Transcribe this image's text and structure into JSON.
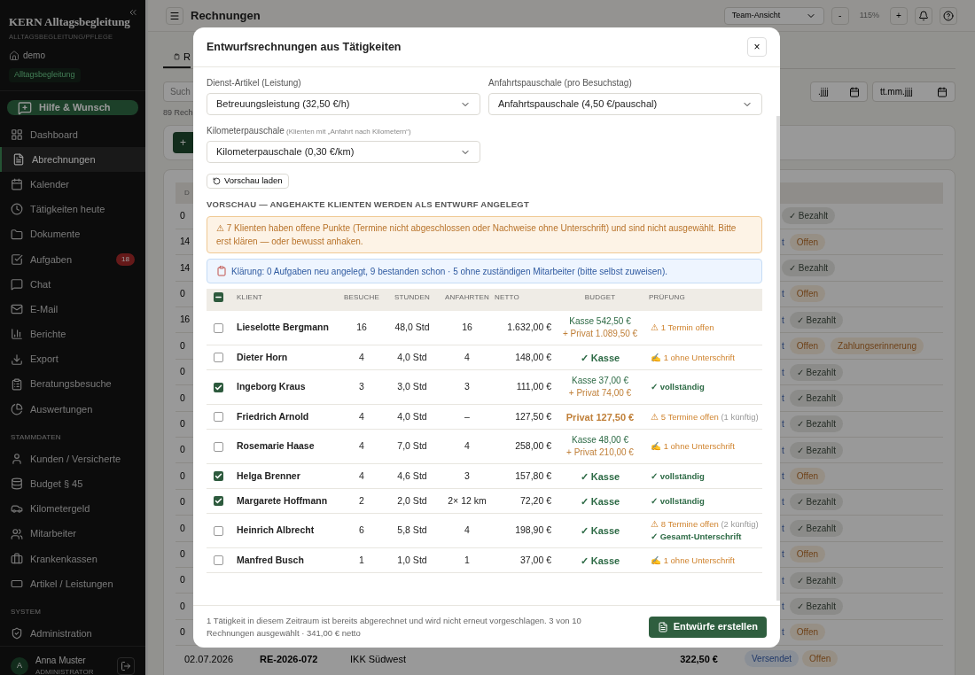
{
  "sidebar": {
    "brand": "KERN Alltagsbegleitung",
    "subtitle": "ALLTAGSBEGLEITUNG/PFLEGE",
    "tenant": "demo",
    "tenant_tag": "Alltagsbegleitung",
    "help_button": "Hilfe & Wunsch",
    "sections": [
      {
        "items": [
          {
            "label": "Dashboard",
            "selected": false
          },
          {
            "label": "Abrechnungen",
            "selected": true
          },
          {
            "label": "Kalender",
            "selected": false
          },
          {
            "label": "Tätigkeiten heute",
            "selected": false
          },
          {
            "label": "Dokumente",
            "selected": false
          },
          {
            "label": "Aufgaben",
            "selected": false,
            "badge": "18"
          },
          {
            "label": "Chat",
            "selected": false
          },
          {
            "label": "E-Mail",
            "selected": false
          },
          {
            "label": "Berichte",
            "selected": false
          },
          {
            "label": "Export",
            "selected": false
          },
          {
            "label": "Beratungsbesuche",
            "selected": false
          },
          {
            "label": "Auswertungen",
            "selected": false
          }
        ]
      },
      {
        "heading": "STAMMDATEN",
        "items": [
          {
            "label": "Kunden / Versicherte",
            "selected": false
          },
          {
            "label": "Budget § 45",
            "selected": false
          },
          {
            "label": "Kilometergeld",
            "selected": false
          },
          {
            "label": "Mitarbeiter",
            "selected": false
          },
          {
            "label": "Krankenkassen",
            "selected": false
          },
          {
            "label": "Artikel / Leistungen",
            "selected": false
          }
        ]
      },
      {
        "heading": "SYSTEM",
        "items": [
          {
            "label": "Administration",
            "selected": false
          }
        ]
      }
    ],
    "user": {
      "initial": "A",
      "name": "Anna Muster",
      "role": "ADMINISTRATOR"
    }
  },
  "header": {
    "title": "Rechnungen",
    "view_select": "Team-Ansicht",
    "zoom_out": "-",
    "zoom": "115%",
    "zoom_in": "+"
  },
  "background": {
    "tab": "R",
    "search": "Such",
    "count": "89 Rech",
    "date_from": ".jjjj",
    "date_to": "tt.mm.jjjj",
    "add_button": "+",
    "table_header": "D",
    "rows": [
      {
        "cell": "0",
        "badges": [
          {
            "kind": "paid",
            "text": "✓ Bezahlt"
          }
        ]
      },
      {
        "cell": "14",
        "fragment": "t",
        "badges": [
          {
            "kind": "open",
            "text": "Offen"
          }
        ]
      },
      {
        "cell": "14",
        "badges": [
          {
            "kind": "paid",
            "text": "✓ Bezahlt"
          }
        ]
      },
      {
        "cell": "0",
        "fragment": "t",
        "badges": [
          {
            "kind": "open",
            "text": "Offen"
          }
        ]
      },
      {
        "cell": "16",
        "fragment": "t",
        "badges": [
          {
            "kind": "paid",
            "text": "✓ Bezahlt"
          }
        ]
      },
      {
        "cell": "0",
        "fragment": "t",
        "badges": [
          {
            "kind": "open",
            "text": "Offen"
          },
          {
            "kind": "reminder",
            "text": "Zahlungserinnerung"
          }
        ]
      },
      {
        "cell": "0",
        "fragment": "t",
        "badges": [
          {
            "kind": "paid",
            "text": "✓ Bezahlt"
          }
        ]
      },
      {
        "cell": "0",
        "fragment": "t",
        "badges": [
          {
            "kind": "paid",
            "text": "✓ Bezahlt"
          }
        ]
      },
      {
        "cell": "0",
        "fragment": "t",
        "badges": [
          {
            "kind": "paid",
            "text": "✓ Bezahlt"
          }
        ]
      },
      {
        "cell": "0",
        "fragment": "t",
        "badges": [
          {
            "kind": "paid",
            "text": "✓ Bezahlt"
          }
        ]
      },
      {
        "cell": "0",
        "fragment": "t",
        "badges": [
          {
            "kind": "open",
            "text": "Offen"
          }
        ]
      },
      {
        "cell": "0",
        "fragment": "t",
        "badges": [
          {
            "kind": "paid",
            "text": "✓ Bezahlt"
          }
        ]
      },
      {
        "cell": "0",
        "fragment": "t",
        "badges": [
          {
            "kind": "paid",
            "text": "✓ Bezahlt"
          }
        ]
      },
      {
        "cell": "0",
        "fragment": "t",
        "badges": [
          {
            "kind": "open",
            "text": "Offen"
          }
        ]
      },
      {
        "cell": "0",
        "fragment": "t",
        "badges": [
          {
            "kind": "paid",
            "text": "✓ Bezahlt"
          }
        ]
      },
      {
        "cell": "0",
        "fragment": "t",
        "badges": [
          {
            "kind": "paid",
            "text": "✓ Bezahlt"
          }
        ]
      },
      {
        "cell": "0",
        "fragment": "t",
        "badges": [
          {
            "kind": "open",
            "text": "Offen"
          }
        ]
      }
    ],
    "last_row": {
      "date": "02.07.2026",
      "number": "RE-2026-072",
      "payer": "IKK Südwest",
      "amount": "322,50 €",
      "badges": [
        {
          "kind": "sent",
          "text": "Versendet"
        },
        {
          "kind": "open",
          "text": "Offen"
        }
      ]
    }
  },
  "modal": {
    "title": "Entwurfsrechnungen aus Tätigkeiten",
    "close": "×",
    "fields": [
      {
        "label": "Dienst-Artikel (Leistung)",
        "value": "Betreuungsleistung (32,50 €/h)"
      },
      {
        "label": "Anfahrtspauschale (pro Besuchstag)",
        "value": "Anfahrtspauschale (4,50 €/pauschal)"
      },
      {
        "label": "Kilometerpauschale",
        "hint": "(Klienten mit „Anfahrt nach Kilometern“)",
        "value": "Kilometerpauschale (0,30 €/km)"
      }
    ],
    "preview_button": "Vorschau laden",
    "section_heading": "VORSCHAU — ANGEHAKTE KLIENTEN WERDEN ALS ENTWURF ANGELEGT",
    "warning": "⚠ 7 Klienten haben offene Punkte (Termine nicht abgeschlossen oder Nachweise ohne Unterschrift) und sind nicht ausgewählt. Bitte erst klären — oder bewusst anhaken.",
    "info": "Klärung: 0 Aufgaben neu angelegt, 9 bestanden schon · 5 ohne zuständigen Mitarbeiter (bitte selbst zuweisen).",
    "table": {
      "select_all_indeterminate": true,
      "columns": [
        "KLIENT",
        "BESUCHE",
        "STUNDEN",
        "ANFAHRTEN",
        "NETTO",
        "BUDGET",
        "PRÜFUNG"
      ],
      "rows": [
        {
          "selected": false,
          "client": "Lieselotte Bergmann",
          "visits": "16",
          "hours": "48,0 Std",
          "trips": "16",
          "net": "1.632,00 €",
          "budget": [
            {
              "kind": "kasse-part",
              "text": "Kasse 542,50 €"
            },
            {
              "kind": "privat-part",
              "text": "+ Privat 1.089,50 €"
            }
          ],
          "checks": [
            {
              "kind": "warning",
              "text": "⚠ 1 Termin offen"
            }
          ]
        },
        {
          "selected": false,
          "client": "Dieter Horn",
          "visits": "4",
          "hours": "4,0 Std",
          "trips": "4",
          "net": "148,00 €",
          "budget": [
            {
              "kind": "kasse",
              "text": "✓ Kasse"
            }
          ],
          "checks": [
            {
              "kind": "signature",
              "text": "✍ 1 ohne Unterschrift"
            }
          ]
        },
        {
          "selected": true,
          "client": "Ingeborg Kraus",
          "visits": "3",
          "hours": "3,0 Std",
          "trips": "3",
          "net": "111,00 €",
          "budget": [
            {
              "kind": "kasse-part",
              "text": "Kasse 37,00 €"
            },
            {
              "kind": "privat-part",
              "text": "+ Privat 74,00 €"
            }
          ],
          "checks": [
            {
              "kind": "ok",
              "text": "✓ vollständig"
            }
          ]
        },
        {
          "selected": false,
          "client": "Friedrich Arnold",
          "visits": "4",
          "hours": "4,0 Std",
          "trips": "–",
          "net": "127,50 €",
          "budget": [
            {
              "kind": "privat",
              "text": "Privat 127,50 €"
            }
          ],
          "checks": [
            {
              "kind": "warning",
              "text": "⚠ 5 Termine offen",
              "note": "(1 künftig)"
            }
          ]
        },
        {
          "selected": false,
          "client": "Rosemarie Haase",
          "visits": "4",
          "hours": "7,0 Std",
          "trips": "4",
          "net": "258,00 €",
          "budget": [
            {
              "kind": "kasse-part",
              "text": "Kasse 48,00 €"
            },
            {
              "kind": "privat-part",
              "text": "+ Privat 210,00 €"
            }
          ],
          "checks": [
            {
              "kind": "signature",
              "text": "✍ 1 ohne Unterschrift"
            }
          ]
        },
        {
          "selected": true,
          "client": "Helga Brenner",
          "visits": "4",
          "hours": "4,6 Std",
          "trips": "3",
          "net": "157,80 €",
          "budget": [
            {
              "kind": "kasse",
              "text": "✓ Kasse"
            }
          ],
          "checks": [
            {
              "kind": "ok",
              "text": "✓ vollständig"
            }
          ]
        },
        {
          "selected": true,
          "client": "Margarete Hoffmann",
          "visits": "2",
          "hours": "2,0 Std",
          "trips": "2× 12 km",
          "net": "72,20 €",
          "budget": [
            {
              "kind": "kasse",
              "text": "✓ Kasse"
            }
          ],
          "checks": [
            {
              "kind": "ok",
              "text": "✓ vollständig"
            }
          ]
        },
        {
          "selected": false,
          "client": "Heinrich Albrecht",
          "visits": "6",
          "hours": "5,8 Std",
          "trips": "4",
          "net": "198,90 €",
          "budget": [
            {
              "kind": "kasse",
              "text": "✓ Kasse"
            }
          ],
          "checks": [
            {
              "kind": "warning",
              "text": "⚠ 8 Termine offen",
              "note": "(2 künftig)"
            },
            {
              "kind": "ok",
              "text": "✓ Gesamt-Unterschrift"
            }
          ]
        },
        {
          "selected": false,
          "client": "Manfred Busch",
          "visits": "1",
          "hours": "1,0 Std",
          "trips": "1",
          "net": "37,00 €",
          "budget": [
            {
              "kind": "kasse",
              "text": "✓ Kasse"
            }
          ],
          "checks": [
            {
              "kind": "signature",
              "text": "✍ 1 ohne Unterschrift"
            }
          ]
        }
      ]
    },
    "footer_note": "1 Tätigkeit in diesem Zeitraum ist bereits abgerechnet und wird nicht erneut vorgeschlagen. 3 von 10 Rechnungen ausgewählt · 341,00 € netto",
    "create_button": "Entwürfe erstellen"
  }
}
